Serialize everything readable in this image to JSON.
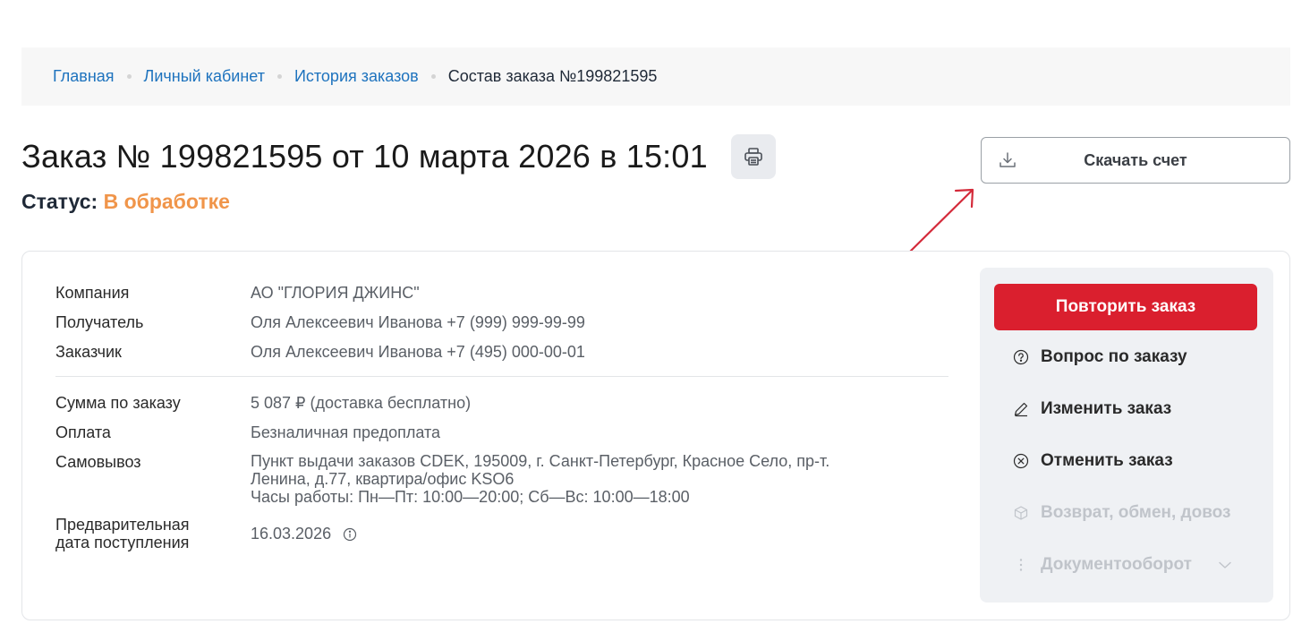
{
  "breadcrumb": {
    "items": [
      "Главная",
      "Личный кабинет",
      "История заказов"
    ],
    "current": "Состав заказа №199821595"
  },
  "order": {
    "title": "Заказ № 199821595 от 10 марта 2026 в 15:01",
    "status_label": "Статус:",
    "status_value": "В обработке"
  },
  "download": {
    "label": "Скачать счет"
  },
  "info": {
    "company_label": "Компания",
    "company_value": "АО \"ГЛОРИЯ ДЖИНС\"",
    "recipient_label": "Получатель",
    "recipient_value": "Оля Алексеевич Иванова +7 (999) 999-99-99",
    "customer_label": "Заказчик",
    "customer_value": "Оля Алексеевич Иванова +7 (495) 000-00-01",
    "sum_label": "Сумма по заказу",
    "sum_value": "5 087 ₽ (доставка бесплатно)",
    "payment_label": "Оплата",
    "payment_value": "Безналичная предоплата",
    "pickup_label": "Самовывоз",
    "pickup_line1": "Пункт выдачи заказов CDEK, 195009, г. Санкт-Петербург, Красное Село, пр-т.",
    "pickup_line2": "Ленина, д.77, квартира/офис KSO6",
    "pickup_line3": "Часы работы: Пн—Пт: 10:00—20:00; Сб—Вс: 10:00—18:00",
    "eta_label_line1": "Предварительная",
    "eta_label_line2": "дата поступления",
    "eta_value": "16.03.2026"
  },
  "actions": {
    "repeat": "Повторить заказ",
    "question": "Вопрос по заказу",
    "edit": "Изменить заказ",
    "cancel": "Отменить заказ",
    "return": "Возврат, обмен, довоз",
    "docs": "Документооборот"
  },
  "colors": {
    "link": "#1e73be",
    "status": "#f0954a",
    "primary_button": "#da1f2e",
    "annotation_arrow": "#d42a3a"
  }
}
